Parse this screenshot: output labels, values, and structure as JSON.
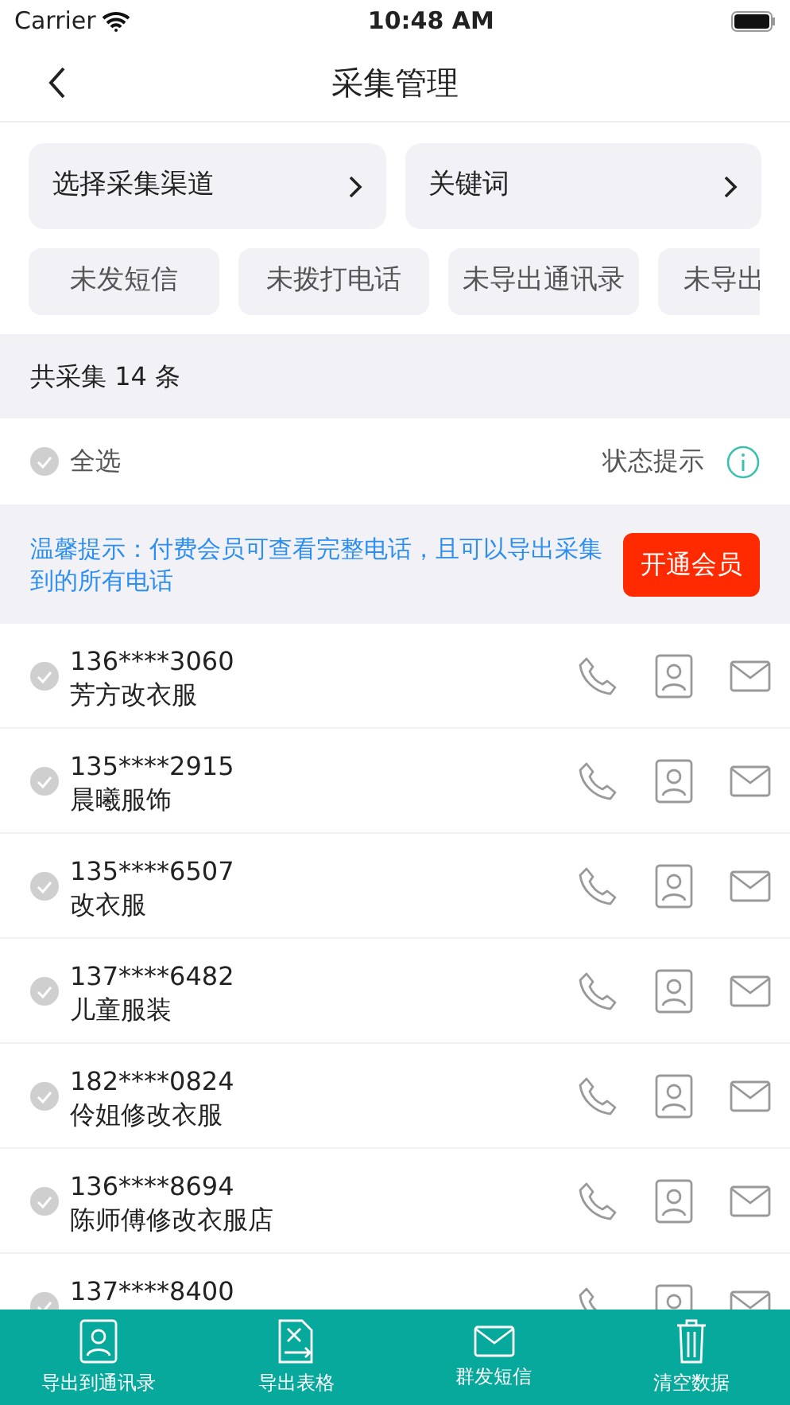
{
  "status_bar": {
    "carrier": "Carrier",
    "time": "10:48 AM"
  },
  "nav": {
    "title": "采集管理"
  },
  "filters": [
    {
      "label": "选择采集渠道"
    },
    {
      "label": "关键词"
    }
  ],
  "tags": [
    {
      "label": "未发短信",
      "selected": false
    },
    {
      "label": "未拨打电话",
      "selected": false
    },
    {
      "label": "未导出通讯录",
      "selected": false
    },
    {
      "label": "未导出",
      "selected": false
    }
  ],
  "summary": "共采集 14 条",
  "select_all": {
    "label": "全选",
    "checked": false
  },
  "status_hint": "状态提示",
  "notice": {
    "text": "温馨提示：付费会员可查看完整电话，且可以导出采集到的所有电话",
    "button": "开通会员"
  },
  "contacts": [
    {
      "phone": "136****3060",
      "name": "芳方改衣服",
      "checked": false
    },
    {
      "phone": "135****2915",
      "name": "晨曦服饰",
      "checked": false
    },
    {
      "phone": "135****6507",
      "name": "改衣服",
      "checked": false
    },
    {
      "phone": "137****6482",
      "name": "儿童服装",
      "checked": false
    },
    {
      "phone": "182****0824",
      "name": "伶姐修改衣服",
      "checked": false
    },
    {
      "phone": "136****8694",
      "name": "陈师傅修改衣服店",
      "checked": false
    },
    {
      "phone": "137****8400",
      "checked": false
    }
  ],
  "bottom_bar": [
    {
      "kind": "contacts",
      "label": "导出到通讯录"
    },
    {
      "kind": "sheet",
      "label": "导出表格"
    },
    {
      "kind": "mail",
      "label": "群发短信"
    },
    {
      "kind": "trash",
      "label": "清空数据"
    }
  ]
}
